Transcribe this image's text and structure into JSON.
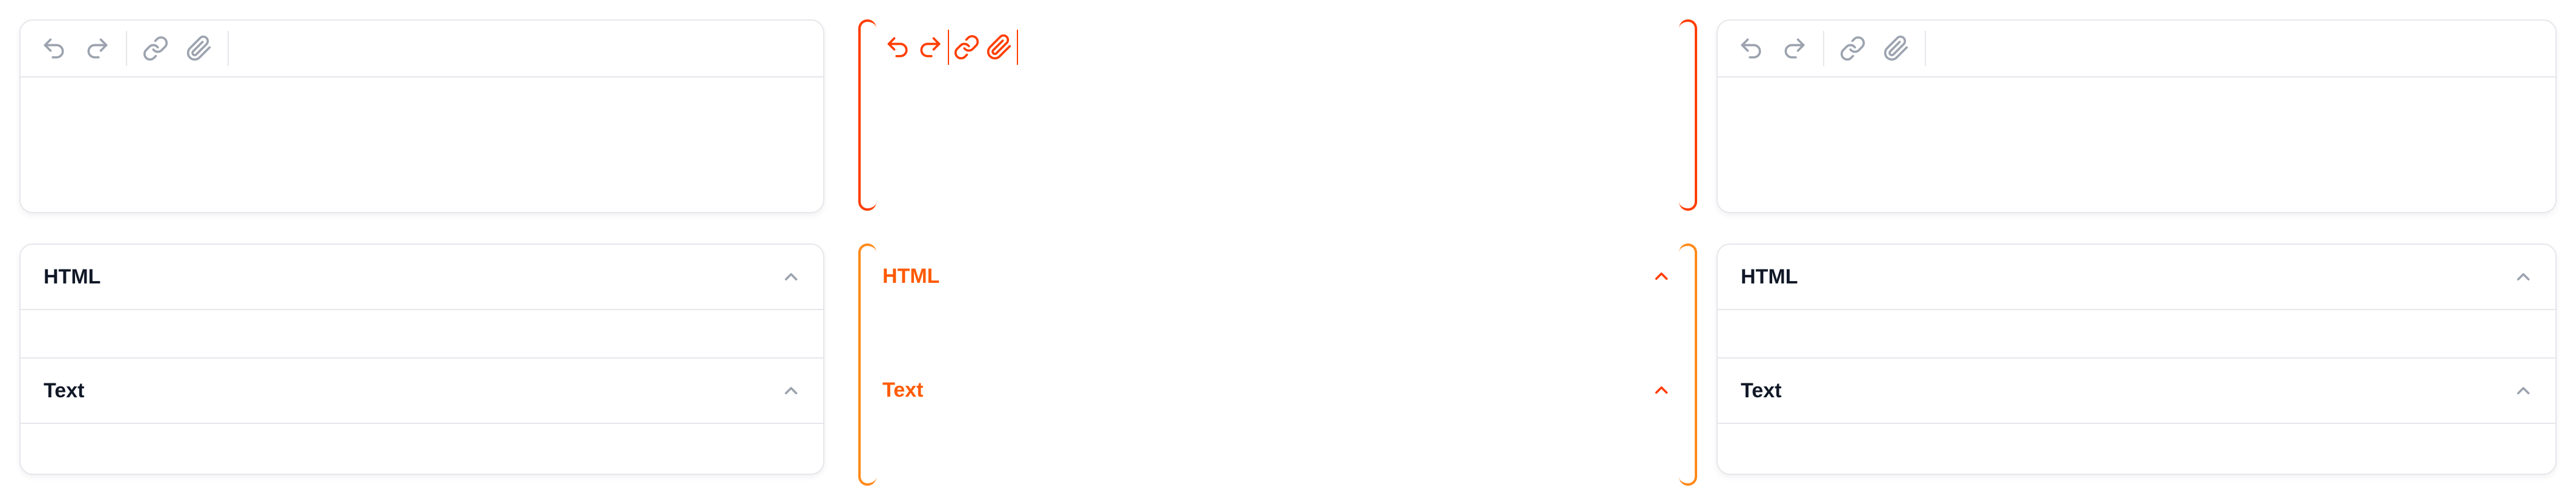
{
  "toolbar": {
    "undo_icon": "undo-icon",
    "redo_icon": "redo-icon",
    "link_icon": "link-icon",
    "attach_icon": "paperclip-icon"
  },
  "preview": {
    "sections": [
      {
        "label": "HTML",
        "icon": "chevron-up-icon"
      },
      {
        "label": "Text",
        "icon": "chevron-up-icon"
      }
    ]
  },
  "colors": {
    "border": "#e5e7eb",
    "icon": "#9ca3af",
    "text": "#111827",
    "accent_red": "#ff3d00",
    "accent_orange": "#ff7a1a"
  }
}
